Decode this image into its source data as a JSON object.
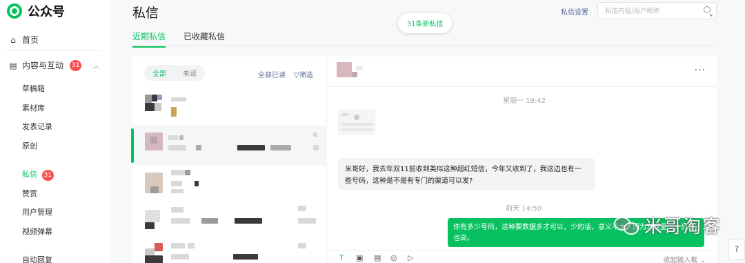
{
  "app": {
    "name": "公众号"
  },
  "sidebar": {
    "home": "首页",
    "content_section": {
      "label": "内容与互动",
      "badge": "31"
    },
    "items": [
      {
        "label": "草稿箱"
      },
      {
        "label": "素材库"
      },
      {
        "label": "发表记录"
      },
      {
        "label": "原创"
      },
      {
        "label": "私信",
        "badge": "31",
        "active": true
      },
      {
        "label": "赞赏"
      },
      {
        "label": "用户管理"
      },
      {
        "label": "视频弹幕"
      },
      {
        "label": "自动回复"
      }
    ]
  },
  "header": {
    "title": "私信",
    "settings_label": "私信设置",
    "search_placeholder": "私信内容/用户昵称",
    "new_messages_label": "31条新私信",
    "tabs": [
      {
        "label": "近期私信",
        "active": true
      },
      {
        "label": "已收藏私信",
        "active": false
      }
    ]
  },
  "list": {
    "filters": [
      {
        "label": "全部",
        "active": true
      },
      {
        "label": "未读",
        "active": false
      }
    ],
    "mark_all_read": "全部已读",
    "filter_label": "筛选"
  },
  "chat": {
    "timestamp_1": "星期一 19:42",
    "incoming_message": "米哥好，我去年双11前收到类似这种超红短信，今年又收到了，我这边也有一些号码，这种是不是有专门的渠道可以发?",
    "timestamp_2": "前天 14:50",
    "outgoing_message": "你有多少号码，这种要数据多才可以，少的话，意义不大，因为发送量少，价格也高。",
    "collapse_input_label": "收起输入框"
  },
  "watermark": {
    "text": "米哥淘客"
  },
  "colors": {
    "accent": "#07c160",
    "badge": "#fa5151",
    "link": "#576b95"
  },
  "icons": [
    "home-icon",
    "document-icon",
    "chevron-up-icon",
    "search-icon",
    "filter-icon",
    "more-icon",
    "text-icon",
    "image-icon",
    "file-icon",
    "video-icon",
    "play-icon",
    "help-icon"
  ]
}
